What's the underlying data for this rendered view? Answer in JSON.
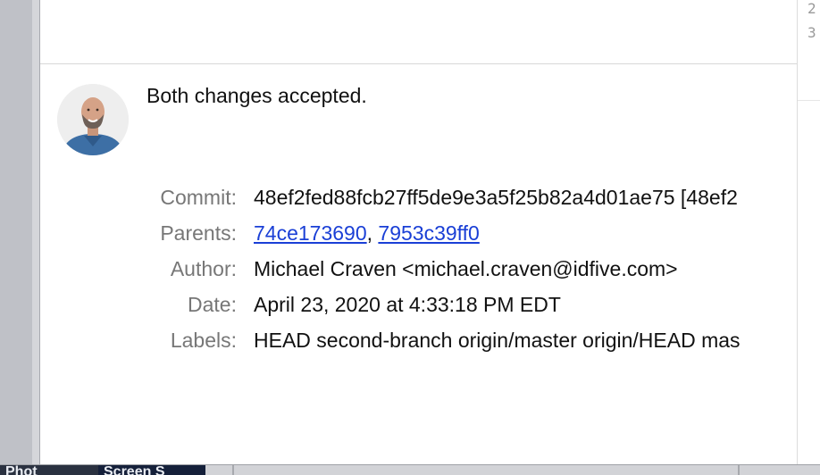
{
  "right_gutter": {
    "line_numbers": [
      "2",
      "3"
    ]
  },
  "commit": {
    "message": "Both changes accepted.",
    "labels": {
      "commit": "Commit:",
      "parents": "Parents:",
      "author": "Author:",
      "date": "Date:",
      "labels": "Labels:"
    },
    "hash": "48ef2fed88fcb27ff5de9e3a5f25b82a4d01ae75 [48ef2",
    "parents": [
      "74ce173690",
      "7953c39ff0"
    ],
    "parents_separator": ", ",
    "author": "Michael Craven <michael.craven@idfive.com>",
    "date": "April 23, 2020 at 4:33:18 PM EDT",
    "refs": "HEAD second-branch origin/master origin/HEAD mas"
  },
  "dock": {
    "thumb_1_label": "Phot",
    "thumb_2_label": "Screen S"
  },
  "colors": {
    "link": "#1a3fd6",
    "label_gray": "#777777",
    "text": "#111111"
  }
}
